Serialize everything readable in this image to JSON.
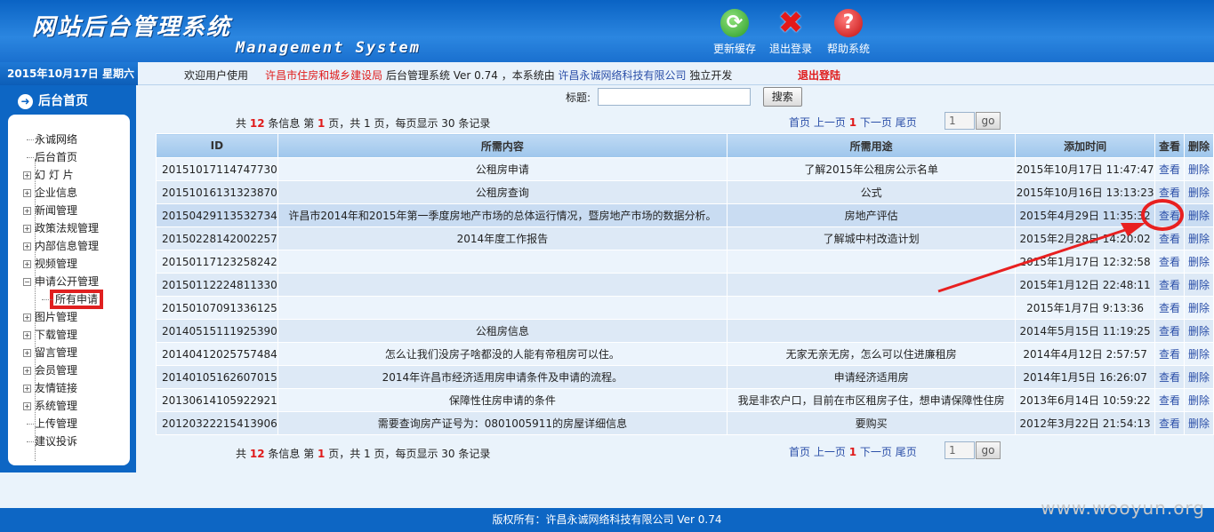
{
  "header": {
    "title": "网站后台管理系统",
    "subtitle": "Management System",
    "tools": [
      {
        "label": "更新缓存",
        "icon": "refresh-icon"
      },
      {
        "label": "退出登录",
        "icon": "exit-icon"
      },
      {
        "label": "帮助系统",
        "icon": "help-icon"
      }
    ]
  },
  "infobar": {
    "date": "2015年10月17日 星期六",
    "welcome_prefix": "欢迎用户使用",
    "org": "许昌市住房和城乡建设局",
    "system_text": "后台管理系统 Ver 0.74 ，本系统由",
    "company": "许昌永诚网络科技有限公司",
    "suffix": "独立开发",
    "logout": "退出登陆"
  },
  "sidebar": {
    "home_label": "后台首页",
    "items": [
      {
        "label": "永诚网络",
        "expandable": false,
        "sub": false
      },
      {
        "label": "后台首页",
        "expandable": false,
        "sub": false
      },
      {
        "label": "幻 灯 片",
        "expandable": true,
        "sub": false
      },
      {
        "label": "企业信息",
        "expandable": true,
        "sub": false
      },
      {
        "label": "新闻管理",
        "expandable": true,
        "sub": false
      },
      {
        "label": "政策法规管理",
        "expandable": true,
        "sub": false
      },
      {
        "label": "内部信息管理",
        "expandable": true,
        "sub": false
      },
      {
        "label": "视频管理",
        "expandable": true,
        "sub": false
      },
      {
        "label": "申请公开管理",
        "expandable": true,
        "expanded": true,
        "sub": false
      },
      {
        "label": "所有申请",
        "expandable": false,
        "sub": true,
        "highlighted": true
      },
      {
        "label": "图片管理",
        "expandable": true,
        "sub": false
      },
      {
        "label": "下载管理",
        "expandable": true,
        "sub": false
      },
      {
        "label": "留言管理",
        "expandable": true,
        "sub": false
      },
      {
        "label": "会员管理",
        "expandable": true,
        "sub": false
      },
      {
        "label": "友情链接",
        "expandable": true,
        "sub": false
      },
      {
        "label": "系统管理",
        "expandable": true,
        "sub": false
      },
      {
        "label": "上传管理",
        "expandable": false,
        "sub": false
      },
      {
        "label": "建议投诉",
        "expandable": false,
        "sub": false
      }
    ]
  },
  "search": {
    "label": "标题:",
    "value": "",
    "button": "搜索"
  },
  "pager": {
    "prefix": "共",
    "total": "12",
    "mid1": "条信息 第",
    "page": "1",
    "mid2": "页，共 1 页，每页显示 30 条记录",
    "first": "首页",
    "prev": "上一页",
    "current": "1",
    "next": "下一页",
    "last": "尾页",
    "input_value": "1",
    "go": "go"
  },
  "table": {
    "columns": [
      "ID",
      "所需内容",
      "所需用途",
      "添加时间",
      "查看",
      "删除"
    ],
    "view_label": "查看",
    "delete_label": "删除",
    "rows": [
      {
        "id": "20151017114747730",
        "content": "公租房申请",
        "purpose": "了解2015年公租房公示名单",
        "time": "2015年10月17日 11:47:47"
      },
      {
        "id": "20151016131323870",
        "content": "公租房查询",
        "purpose": "公式",
        "time": "2015年10月16日 13:13:23"
      },
      {
        "id": "20150429113532734",
        "content": "许昌市2014年和2015年第一季度房地产市场的总体运行情况，暨房地产市场的数据分析。",
        "purpose": "房地产评估",
        "time": "2015年4月29日 11:35:32"
      },
      {
        "id": "20150228142002257",
        "content": "2014年度工作报告",
        "purpose": "了解城中村改造计划",
        "time": "2015年2月28日 14:20:02"
      },
      {
        "id": "20150117123258242",
        "content": "",
        "purpose": "",
        "time": "2015年1月17日 12:32:58"
      },
      {
        "id": "20150112224811330",
        "content": "",
        "purpose": "",
        "time": "2015年1月12日 22:48:11"
      },
      {
        "id": "20150107091336125",
        "content": "",
        "purpose": "",
        "time": "2015年1月7日 9:13:36"
      },
      {
        "id": "20140515111925390",
        "content": "公租房信息",
        "purpose": "",
        "time": "2014年5月15日 11:19:25"
      },
      {
        "id": "20140412025757484",
        "content": "怎么让我们没房子啥都没的人能有帝租房可以住。",
        "purpose": "无家无亲无房，怎么可以住进廉租房",
        "time": "2014年4月12日 2:57:57"
      },
      {
        "id": "20140105162607015",
        "content": "2014年许昌市经济适用房申请条件及申请的流程。",
        "purpose": "申请经济适用房",
        "time": "2014年1月5日 16:26:07"
      },
      {
        "id": "20130614105922921",
        "content": "保障性住房申请的条件",
        "purpose": "我是非农户口，目前在市区租房子住，想申请保障性住房",
        "time": "2013年6月14日 10:59:22"
      },
      {
        "id": "20120322215413906",
        "content": "需要查询房产证号为：0801005911的房屋详细信息",
        "purpose": "要购买",
        "time": "2012年3月22日 21:54:13"
      }
    ]
  },
  "footer": {
    "text": "版权所有：许昌永诚网络科技有限公司 Ver 0.74"
  },
  "watermark": "www.wooyun.org",
  "colors": {
    "header_blue": "#1a70cf",
    "sidebar_blue": "#0d66c4",
    "accent_red": "#e01b1b",
    "annotation_red": "#e82020"
  }
}
